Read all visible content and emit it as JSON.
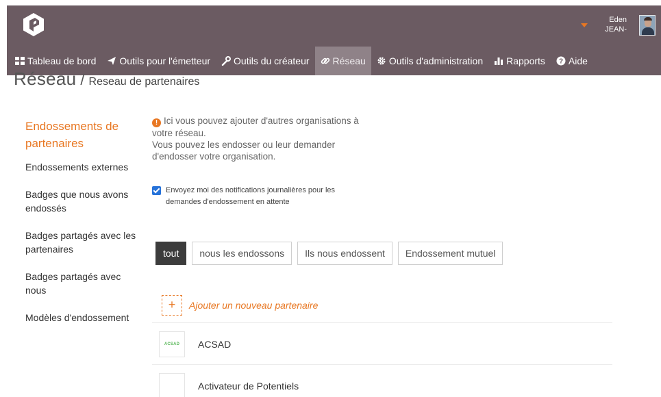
{
  "header": {
    "user": {
      "first_name": "Eden",
      "last_name": "JEAN-"
    },
    "nav": [
      {
        "label": "Tableau de bord",
        "icon": "dashboard-icon"
      },
      {
        "label": "Outils pour l'émetteur",
        "icon": "send-icon"
      },
      {
        "label": "Outils du créateur",
        "icon": "wrench-icon"
      },
      {
        "label": "Réseau",
        "icon": "link-icon",
        "active": true
      },
      {
        "label": "Outils d'administration",
        "icon": "gear-icon"
      },
      {
        "label": "Rapports",
        "icon": "bar-chart-icon"
      },
      {
        "label": "Aide",
        "icon": "question-icon"
      }
    ]
  },
  "breadcrumb": {
    "root": "Réseau",
    "separator": "/",
    "current": "Reseau de partenaires"
  },
  "sidebar": {
    "title": "Endossements de partenaires",
    "items": [
      "Endossements externes",
      "Badges que nous avons endossés",
      "Badges partagés avec les partenaires",
      "Badges partagés avec nous",
      "Modèles d'endossement"
    ]
  },
  "info": {
    "line1": "Ici vous pouvez ajouter d'autres organisations à votre réseau.",
    "line2": "Vous pouvez les endosser ou leur demander d'endosser votre organisation."
  },
  "notification": {
    "checked": true,
    "label": "Envoyez moi des notifications journalières pour les demandes d'endossement en attente"
  },
  "filters": [
    "tout",
    "nous les endossons",
    "Ils nous endossent",
    "Endossement mutuel"
  ],
  "add_partner_label": "Ajouter un nouveau partenaire",
  "partners": [
    {
      "name": "ACSAD",
      "logo_text": "ACSAD"
    },
    {
      "name": "Activateur de Potentiels",
      "logo_text": ""
    }
  ],
  "colors": {
    "header": "#6b5b62",
    "active_nav": "#8f8288",
    "accent": "#e87722",
    "checkbox": "#2672d9"
  }
}
